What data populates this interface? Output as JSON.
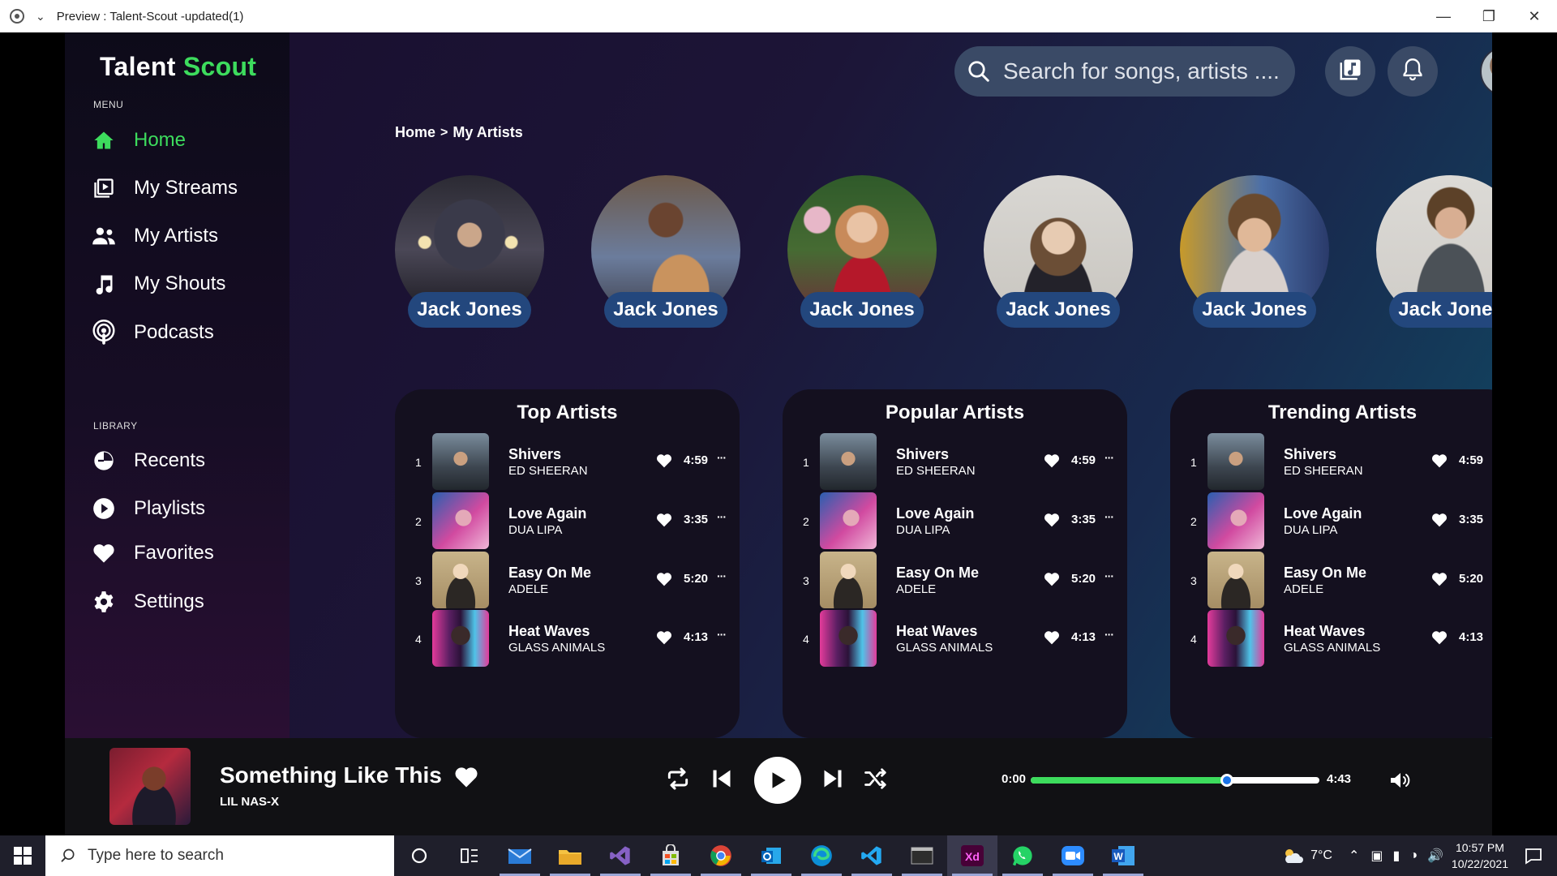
{
  "window": {
    "title": "Preview : Talent-Scout -updated(1)",
    "controls": [
      "minimize",
      "restore",
      "close"
    ]
  },
  "app": {
    "logo_part1": "Talent",
    "logo_part2": "Scout",
    "accent_color": "#3ddc5d",
    "pill_color": "#23477d",
    "card_color": "#14101f"
  },
  "sidebar": {
    "menu_label": "MENU",
    "library_label": "LIBRARY",
    "menu": [
      {
        "label": "Home",
        "icon": "home-icon",
        "active": true
      },
      {
        "label": "My Streams",
        "icon": "streams-icon",
        "active": false
      },
      {
        "label": "My Artists",
        "icon": "artists-icon",
        "active": false
      },
      {
        "label": "My Shouts",
        "icon": "music-note-icon",
        "active": false
      },
      {
        "label": "Podcasts",
        "icon": "podcast-icon",
        "active": false
      }
    ],
    "library": [
      {
        "label": "Recents",
        "icon": "clock-icon"
      },
      {
        "label": "Playlists",
        "icon": "play-circle-icon"
      },
      {
        "label": "Favorites",
        "icon": "heart-icon"
      },
      {
        "label": "Settings",
        "icon": "gear-icon"
      }
    ]
  },
  "header": {
    "search_placeholder": "Search for songs, artists ....",
    "buttons": [
      "library-music-icon",
      "bell-icon"
    ]
  },
  "breadcrumb": {
    "home": "Home",
    "separator": ">",
    "current": "My Artists"
  },
  "artists": [
    {
      "name": "Jack Jones"
    },
    {
      "name": "Jack Jones"
    },
    {
      "name": "Jack Jones"
    },
    {
      "name": "Jack Jones"
    },
    {
      "name": "Jack Jones"
    },
    {
      "name": "Jack Jones"
    }
  ],
  "cards": [
    {
      "title": "Top Artists",
      "songs": [
        {
          "rank": "1",
          "title": "Shivers",
          "artist": "ED SHEERAN",
          "duration": "4:59",
          "more": "···"
        },
        {
          "rank": "2",
          "title": "Love Again",
          "artist": "DUA LIPA",
          "duration": "3:35",
          "more": "···"
        },
        {
          "rank": "3",
          "title": "Easy On Me",
          "artist": "ADELE",
          "duration": "5:20",
          "more": "···"
        },
        {
          "rank": "4",
          "title": "Heat Waves",
          "artist": "GLASS ANIMALS",
          "duration": "4:13",
          "more": "···"
        }
      ]
    },
    {
      "title": "Popular Artists",
      "songs": [
        {
          "rank": "1",
          "title": "Shivers",
          "artist": "ED SHEERAN",
          "duration": "4:59",
          "more": "···"
        },
        {
          "rank": "2",
          "title": "Love Again",
          "artist": "DUA LIPA",
          "duration": "3:35",
          "more": "···"
        },
        {
          "rank": "3",
          "title": "Easy On Me",
          "artist": "ADELE",
          "duration": "5:20",
          "more": "···"
        },
        {
          "rank": "4",
          "title": "Heat Waves",
          "artist": "GLASS ANIMALS",
          "duration": "4:13",
          "more": "···"
        }
      ]
    },
    {
      "title": "Trending Artists",
      "songs": [
        {
          "rank": "1",
          "title": "Shivers",
          "artist": "ED SHEERAN",
          "duration": "4:59",
          "more": "···"
        },
        {
          "rank": "2",
          "title": "Love Again",
          "artist": "DUA LIPA",
          "duration": "3:35",
          "more": "···"
        },
        {
          "rank": "3",
          "title": "Easy On Me",
          "artist": "ADELE",
          "duration": "5:20",
          "more": "···"
        },
        {
          "rank": "4",
          "title": "Heat Waves",
          "artist": "GLASS ANIMALS",
          "duration": "4:13",
          "more": "···"
        }
      ]
    }
  ],
  "player": {
    "title": "Something Like This",
    "artist": "LIL NAS-X",
    "current_time": "0:00",
    "total_time": "4:43",
    "progress_fraction": 0.68,
    "controls": [
      "repeat-icon",
      "skip-previous-icon",
      "play-icon",
      "skip-next-icon",
      "shuffle-icon",
      "volume-icon"
    ]
  },
  "taskbar": {
    "search_placeholder": "Type here to search",
    "weather": "7°C",
    "time": "10:57 PM",
    "date": "10/22/2021",
    "apps": [
      "cortana-icon",
      "task-view-icon",
      "mail-icon",
      "file-explorer-icon",
      "visual-studio-icon",
      "store-icon",
      "chrome-icon",
      "outlook-icon",
      "edge-icon",
      "vscode-icon",
      "terminal-icon",
      "adobe-xd-icon",
      "whatsapp-icon",
      "zoom-icon",
      "word-icon"
    ]
  }
}
